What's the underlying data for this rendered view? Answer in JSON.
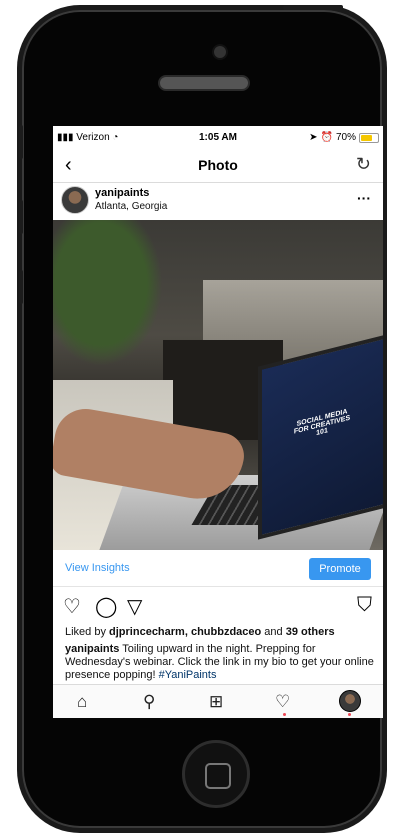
{
  "status": {
    "carrier": "Verizon",
    "time": "1:05 AM",
    "battery": "70%",
    "battery_level": 0.7
  },
  "nav": {
    "title": "Photo",
    "back_icon": "chevron-left-icon",
    "refresh_icon": "refresh-icon"
  },
  "post": {
    "username": "yanipaints",
    "location": "Atlanta, Georgia",
    "image_text": "SOCIAL MEDIA FOR CREATIVES 101",
    "view_insights": "View Insights",
    "promote": "Promote",
    "liked_prefix": "Liked by ",
    "liked_users": "djprincecharm, chubbzdaceo",
    "liked_and": " and ",
    "liked_count": "39 others",
    "caption_user": "yanipaints",
    "caption_text": " Toiling upward in the night. Prepping for Wednesday's webinar. Click the link in my bio to get your online presence popping! ",
    "caption_tag": "#YaniPaints"
  },
  "tabbar": {
    "icons": [
      "home-icon",
      "search-icon",
      "add-icon",
      "heart-icon",
      "profile-icon"
    ]
  },
  "colors": {
    "accent": "#3897f0",
    "notification": "#ed4956"
  }
}
